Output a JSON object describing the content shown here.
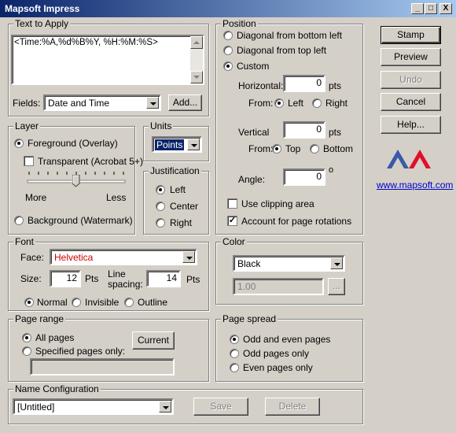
{
  "window": {
    "title": "Mapsoft Impress",
    "minimize": "_",
    "maximize": "□",
    "close": "X"
  },
  "text_to_apply": {
    "label": "Text to Apply",
    "value": "<Time:%A,%d%B%Y, %H:%M:%S>",
    "fields_label": "Fields:",
    "fields_value": "Date and Time",
    "add_button": "Add..."
  },
  "layer": {
    "label": "Layer",
    "foreground": "Foreground (Overlay)",
    "transparent": "Transparent (Acrobat 5+)",
    "more": "More",
    "less": "Less",
    "background": "Background (Watermark)",
    "selected": "foreground",
    "transparent_checked": false,
    "opacity_level": 0.5
  },
  "units": {
    "label": "Units",
    "value": "Points"
  },
  "justification": {
    "label": "Justification",
    "options": [
      "Left",
      "Center",
      "Right"
    ],
    "selected": "Left"
  },
  "position": {
    "label": "Position",
    "options": [
      "Diagonal from bottom left",
      "Diagonal from top left",
      "Custom"
    ],
    "selected": "Custom",
    "horizontal_label": "Horizontal:",
    "horizontal_value": "0",
    "horizontal_unit": "pts",
    "h_from_label": "From:",
    "h_from_options": [
      "Left",
      "Right"
    ],
    "h_from_selected": "Left",
    "vertical_label": "Vertical",
    "vertical_value": "0",
    "vertical_unit": "pts",
    "v_from_label": "From:",
    "v_from_options": [
      "Top",
      "Bottom"
    ],
    "v_from_selected": "Top",
    "angle_label": "Angle:",
    "angle_value": "0",
    "angle_unit": "o",
    "clipping": "Use clipping area",
    "clipping_checked": false,
    "rotations": "Account for page rotations",
    "rotations_checked": true
  },
  "actions": {
    "stamp": "Stamp",
    "preview": "Preview",
    "undo": "Undo",
    "cancel": "Cancel",
    "help": "Help...",
    "website": "www.mapsoft.com",
    "logo_colors": [
      "#3a5aa8",
      "#e0102a"
    ]
  },
  "font": {
    "label": "Font",
    "face_label": "Face:",
    "face_value": "Helvetica",
    "face_color": "#cc0000",
    "size_label": "Size:",
    "size_value": "12",
    "size_unit": "Pts",
    "spacing_label_1": "Line",
    "spacing_label_2": "spacing:",
    "spacing_value": "14",
    "spacing_unit": "Pts",
    "style_options": [
      "Normal",
      "Invisible",
      "Outline"
    ],
    "style_selected": "Normal"
  },
  "color": {
    "label": "Color",
    "value": "Black",
    "opacity_value": "1.00",
    "browse": "..."
  },
  "page_range": {
    "label": "Page range",
    "all_pages": "All pages",
    "specified": "Specified pages only:",
    "current_button": "Current",
    "selected": "all"
  },
  "page_spread": {
    "label": "Page spread",
    "options": [
      "Odd and even pages",
      "Odd pages only",
      "Even pages only"
    ],
    "selected": "Odd and even pages"
  },
  "name_config": {
    "label": "Name Configuration",
    "value": "[Untitled]",
    "save_button": "Save",
    "delete_button": "Delete"
  }
}
